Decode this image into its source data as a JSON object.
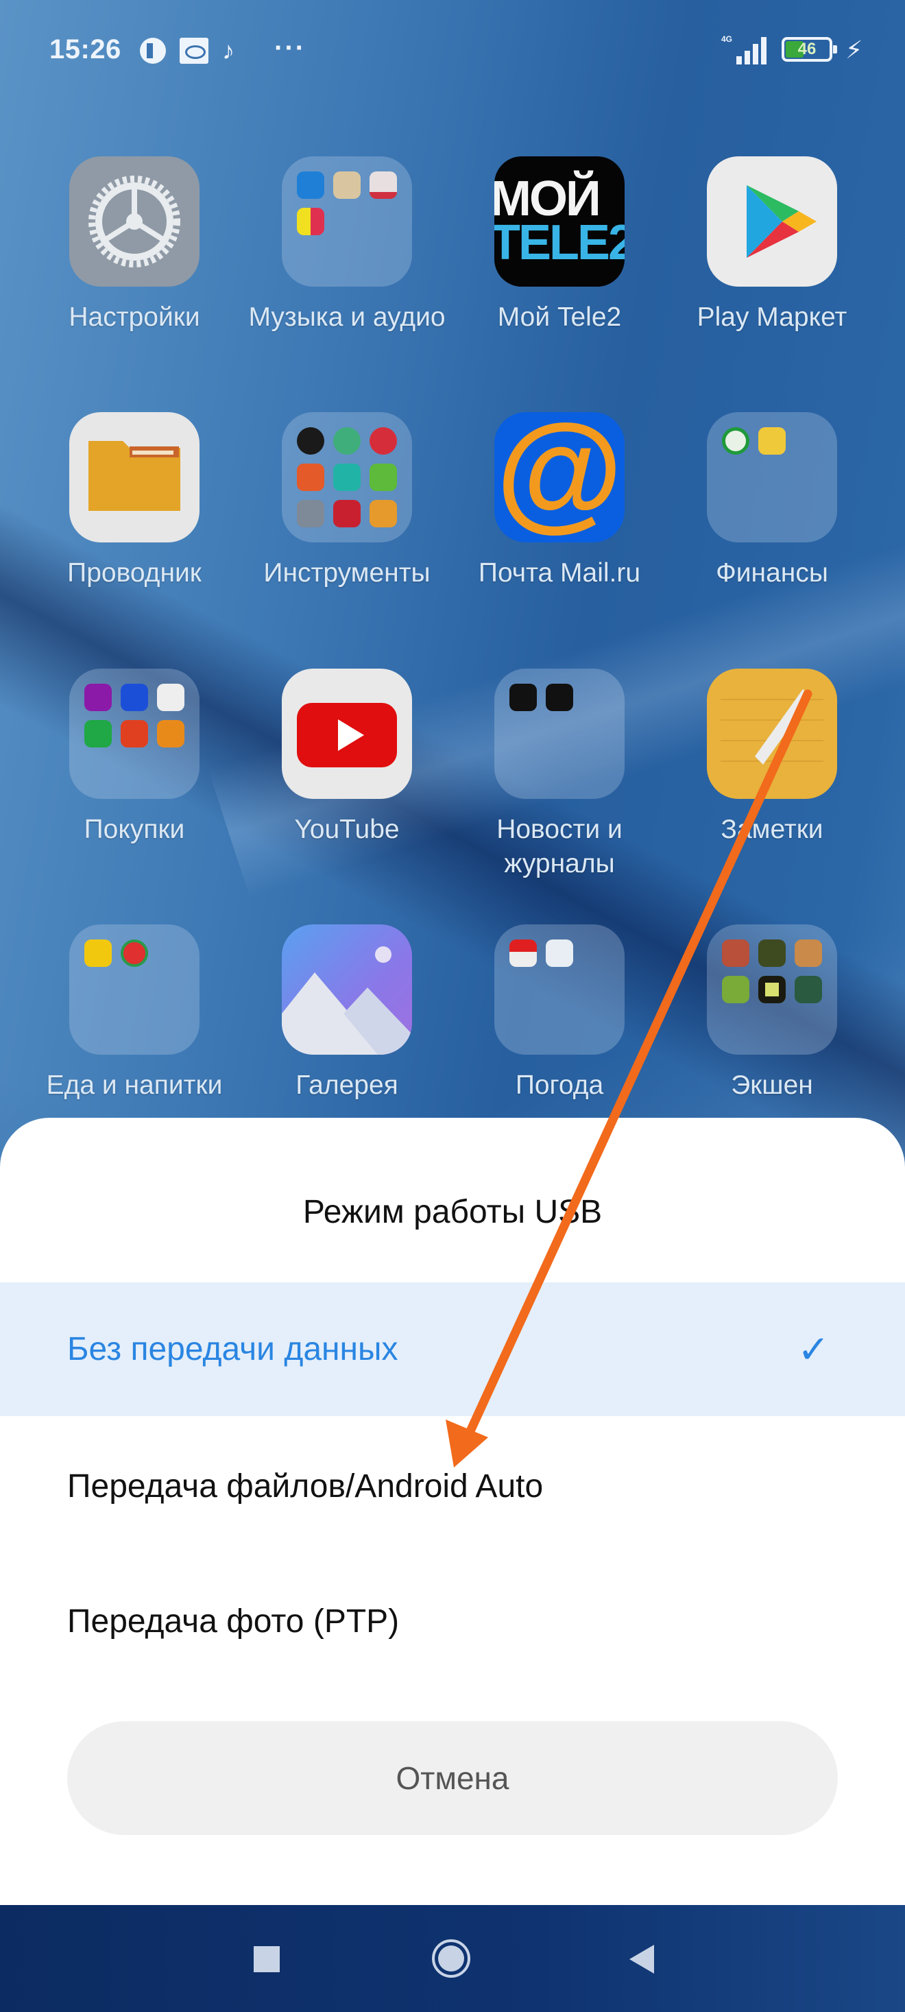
{
  "status_bar": {
    "time": "15:26",
    "notification_icons": [
      "tele2-icon",
      "screen-record-icon",
      "tiktok-icon"
    ],
    "more": "···",
    "network": "4G",
    "battery_percent": 46,
    "battery_label": "46",
    "charging": true
  },
  "home_screen": {
    "apps": [
      {
        "label": "Настройки",
        "type": "app",
        "icon": "settings-gear-icon"
      },
      {
        "label": "Музыка и аудио",
        "type": "folder"
      },
      {
        "label": "Мой Tele2",
        "type": "app",
        "icon": "tele2-icon",
        "icon_text": "МОЙ TELE2"
      },
      {
        "label": "Play Маркет",
        "type": "app",
        "icon": "play-store-icon"
      },
      {
        "label": "Проводник",
        "type": "app",
        "icon": "folder-icon"
      },
      {
        "label": "Инструменты",
        "type": "folder"
      },
      {
        "label": "Почта Mail.ru",
        "type": "app",
        "icon": "mail-at-icon",
        "icon_text": "@"
      },
      {
        "label": "Финансы",
        "type": "folder"
      },
      {
        "label": "Покупки",
        "type": "folder"
      },
      {
        "label": "YouTube",
        "type": "app",
        "icon": "youtube-icon"
      },
      {
        "label": "Новости и журналы",
        "type": "folder"
      },
      {
        "label": "Заметки",
        "type": "app",
        "icon": "notes-icon"
      },
      {
        "label": "Еда и напитки",
        "type": "folder"
      },
      {
        "label": "Галерея",
        "type": "app",
        "icon": "gallery-icon"
      },
      {
        "label": "Погода",
        "type": "folder"
      },
      {
        "label": "Экшен",
        "type": "folder"
      }
    ]
  },
  "usb_dialog": {
    "title": "Режим работы USB",
    "options": [
      {
        "label": "Без передачи данных",
        "selected": true
      },
      {
        "label": "Передача файлов/Android Auto",
        "selected": false
      },
      {
        "label": "Передача фото (PTP)",
        "selected": false
      }
    ],
    "check_glyph": "✓",
    "cancel_label": "Отмена",
    "accent_color": "#2a85e2",
    "selected_bg": "#e4effb"
  },
  "annotation": {
    "type": "arrow",
    "color": "#f26a1b",
    "from": "Заметки",
    "to": "Передача файлов/Android Auto"
  },
  "nav_bar": {
    "buttons": [
      "recents",
      "home",
      "back"
    ]
  }
}
